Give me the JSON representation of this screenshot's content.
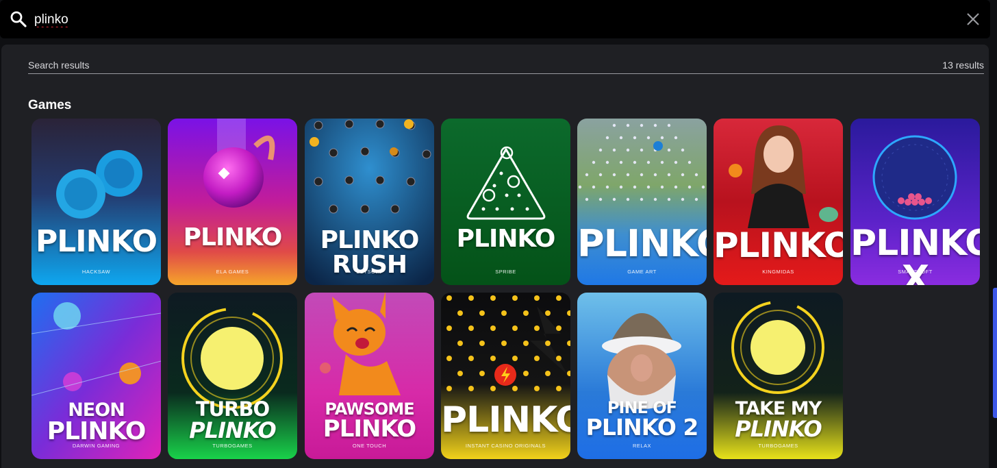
{
  "search": {
    "value": "plinko",
    "placeholder": ""
  },
  "results": {
    "label": "Search results",
    "count": "13 results"
  },
  "section": {
    "title": "Games"
  },
  "games": [
    {
      "title": "PLINKO",
      "provider": "HACKSAW",
      "icon": "overlapping-rings-icon"
    },
    {
      "title": "PLINKO",
      "provider": "ELA GAMES",
      "icon": "magenta-ball-icon"
    },
    {
      "title": "PLINKO RUSH",
      "provider": "BETSOFT",
      "icon": "peg-board-icon"
    },
    {
      "title": "PLINKO",
      "provider": "SPRIBE",
      "icon": "triangle-pegs-icon"
    },
    {
      "title": "PLINKO",
      "provider": "GAME ART",
      "icon": "peg-board-icon"
    },
    {
      "title": "PLINKO",
      "provider": "KINGMIDAS",
      "icon": "woman-character-icon"
    },
    {
      "title": "PLINKO X",
      "provider": "SMARTSOFT",
      "icon": "wheel-icon"
    },
    {
      "title_line1": "NEON",
      "title_line2": "PLINKO",
      "provider": "DARWIN GAMING",
      "icon": "neon-balls-icon"
    },
    {
      "title_line1": "TURBO",
      "title_line2": "PLINKO",
      "provider": "TURBOGAMES",
      "icon": "yellow-ring-icon"
    },
    {
      "title_line1": "PAWSOME",
      "title_line2": "PLINKO",
      "provider": "ONE TOUCH",
      "icon": "orange-cat-icon"
    },
    {
      "title": "PLINKO",
      "provider": "INSTANT CASINO ORIGINALS",
      "icon": "lightning-icon"
    },
    {
      "title_line1": "PINE OF",
      "title_line2": "PLINKO 2",
      "provider": "RELAX",
      "icon": "gnome-icon"
    },
    {
      "title_line1": "TAKE MY",
      "title_line2": "PLINKO",
      "provider": "TURBOGAMES",
      "icon": "yellow-ring-icon"
    }
  ],
  "colors": {
    "accent": "#3d58e8",
    "panel": "#1f2024",
    "bar": "#000000"
  }
}
